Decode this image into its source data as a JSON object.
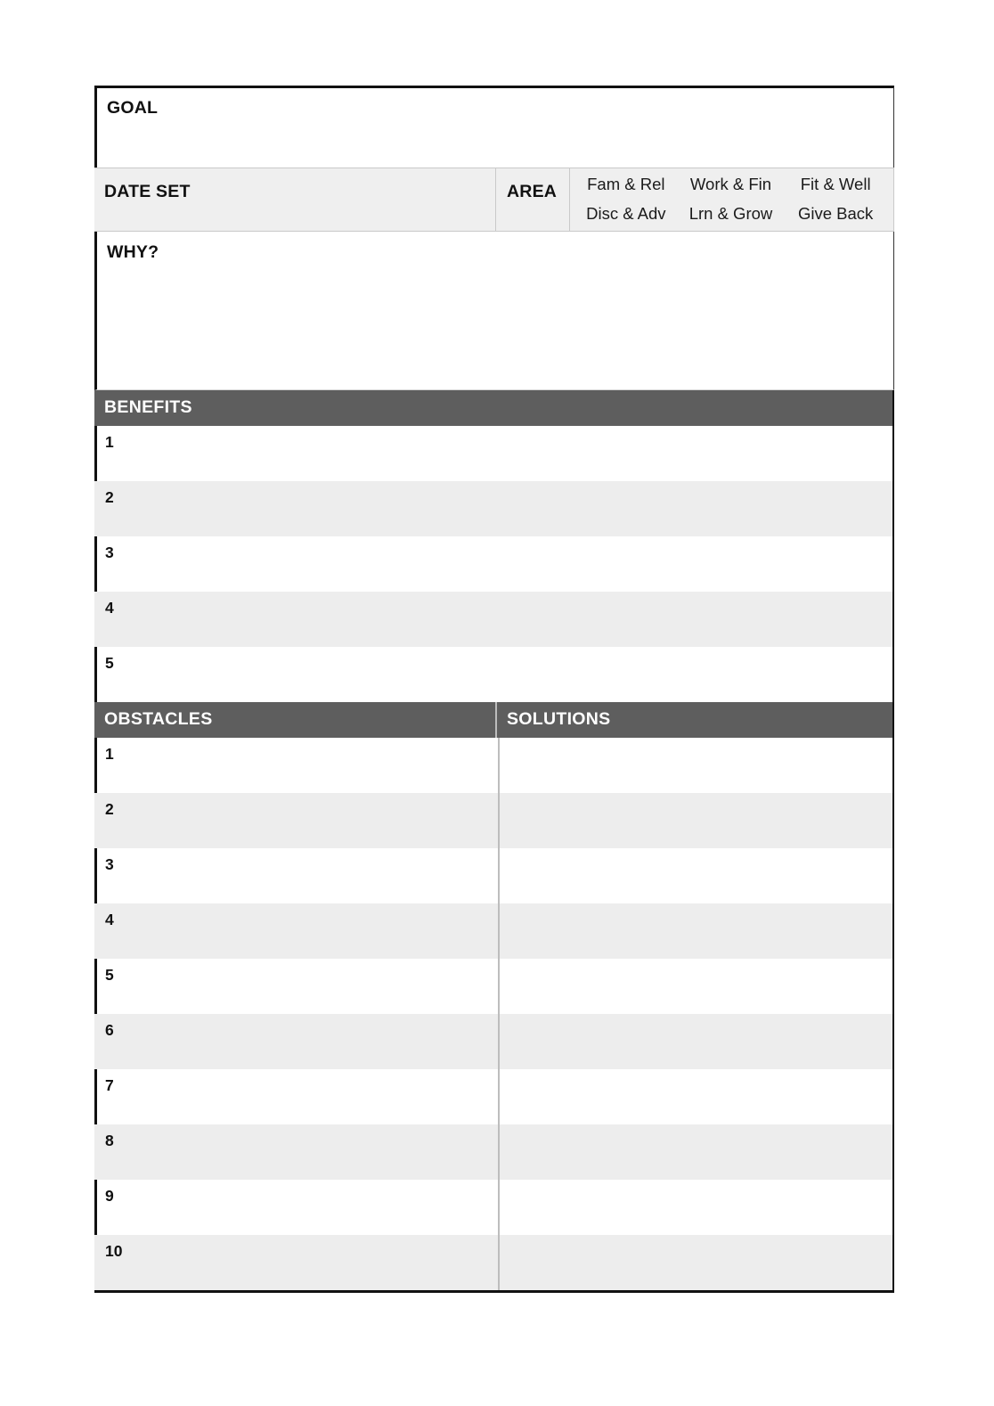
{
  "sections": {
    "goal": {
      "label": "GOAL"
    },
    "date_set": {
      "label": "DATE SET"
    },
    "area": {
      "label": "AREA",
      "options": [
        "Fam & Rel",
        "Work & Fin",
        "Fit & Well",
        "Disc & Adv",
        "Lrn & Grow",
        "Give Back"
      ]
    },
    "why": {
      "label": "WHY?"
    },
    "benefits": {
      "label": "BENEFITS",
      "numbers": [
        "1",
        "2",
        "3",
        "4",
        "5"
      ]
    },
    "obstacles": {
      "label": "OBSTACLES",
      "solutions_label": "SOLUTIONS",
      "numbers": [
        "1",
        "2",
        "3",
        "4",
        "5",
        "6",
        "7",
        "8",
        "9",
        "10"
      ]
    }
  },
  "colors": {
    "header_bar": "#5e5e5e",
    "row_alt": "#ededed",
    "field_gray": "#efefef",
    "rule": "#111111",
    "divider": "#bdbdbd"
  }
}
